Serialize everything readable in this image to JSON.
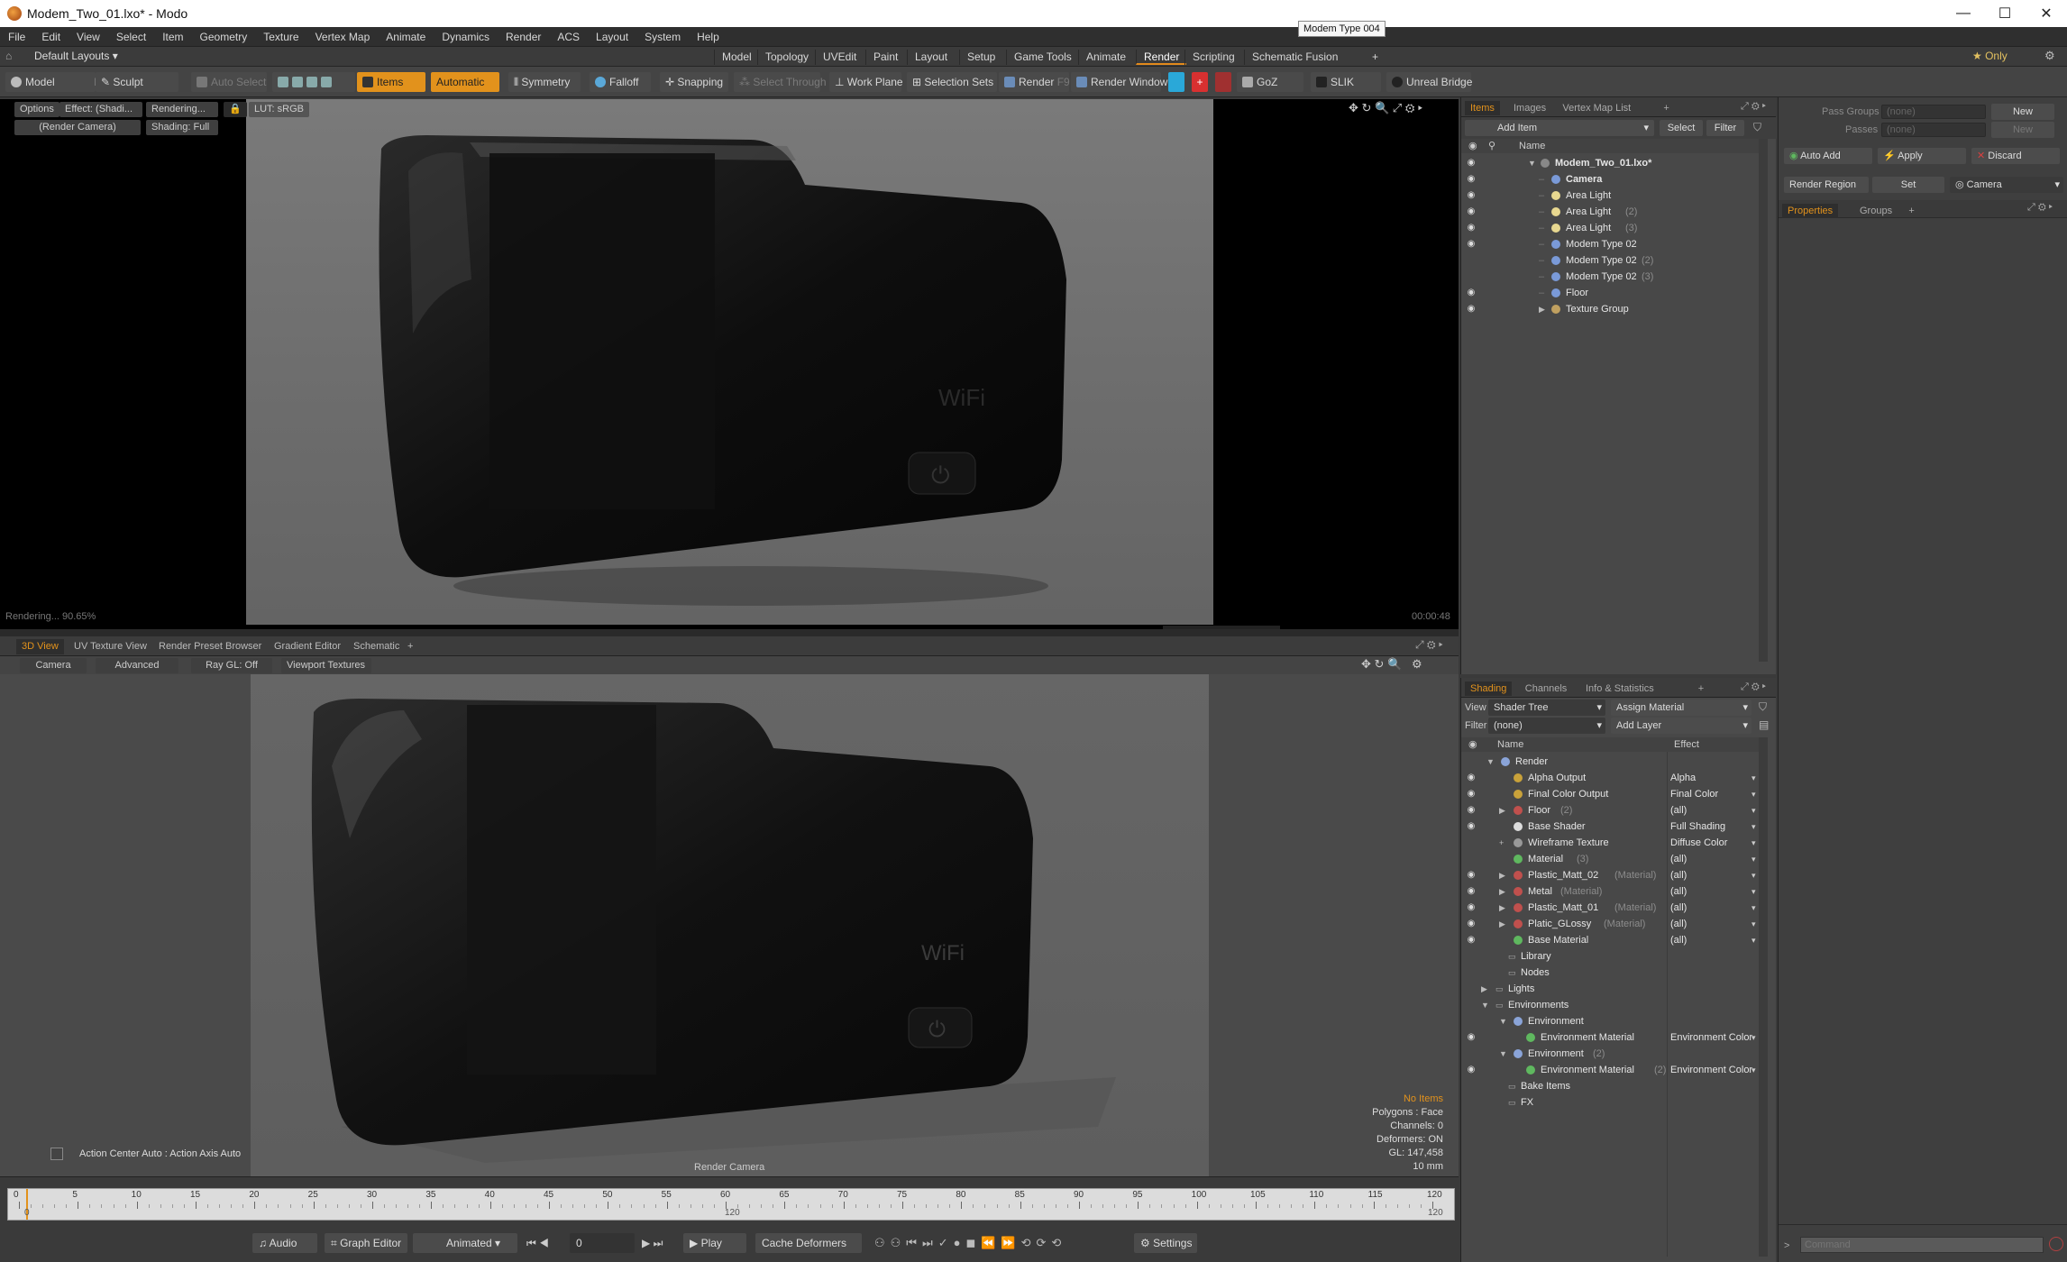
{
  "window": {
    "title": "Modem_Two_01.lxo* - Modo",
    "min": "—",
    "max": "☐",
    "close": "✕"
  },
  "tooltip": "Modem Type 004",
  "menu": [
    "File",
    "Edit",
    "View",
    "Select",
    "Item",
    "Geometry",
    "Texture",
    "Vertex Map",
    "Animate",
    "Dynamics",
    "Render",
    "ACS",
    "Layout",
    "System",
    "Help"
  ],
  "layoutbar": {
    "layouts": "Default Layouts ▾",
    "tabs": [
      "Model",
      "Topology",
      "UVEdit",
      "Paint",
      "Layout",
      "Setup",
      "Game Tools",
      "Animate",
      "Render",
      "Scripting",
      "Schematic Fusion"
    ],
    "active_tab": "Render",
    "plus": "+",
    "only": "★ Only"
  },
  "toolbar": {
    "model": "Model",
    "f2": "F2",
    "sculpt": "Sculpt",
    "auto_select": "Auto Select",
    "items": "Items",
    "automatic": "Automatic",
    "symmetry": "Symmetry",
    "falloff": "Falloff",
    "snapping": "Snapping",
    "select_through": "Select Through",
    "work_plane": "Work Plane",
    "selection_sets": "Selection Sets",
    "render": "Render",
    "f9": "F9",
    "render_window": "Render Window",
    "goz": "GoZ",
    "slik": "SLIK",
    "unreal_bridge": "Unreal Bridge"
  },
  "viewport1": {
    "options": "Options",
    "effect": "Effect: (Shadi...",
    "rendering": "Rendering...",
    "camera": "(Render Camera)",
    "shading": "Shading: Full",
    "lut": "LUT: sRGB",
    "progress": "Rendering... 90.65%",
    "time": "00:00:48"
  },
  "viewport2": {
    "tabs": [
      "3D View",
      "UV Texture View",
      "Render Preset Browser",
      "Gradient Editor",
      "Schematic",
      "+"
    ],
    "active_tab": "3D View",
    "camera": "Camera",
    "advanced": "Advanced",
    "raygl": "Ray GL: Off",
    "textures": "Viewport Textures",
    "action_center": "Action Center Auto : Action Axis Auto",
    "camera_label": "Render Camera",
    "stats": {
      "no_items": "No Items",
      "polygons": "Polygons : Face",
      "channels": "Channels: 0",
      "deformers": "Deformers: ON",
      "gl": "GL: 147,458",
      "unit": "10 mm"
    }
  },
  "timeline": {
    "ticks": [
      "0",
      "5",
      "10",
      "15",
      "20",
      "25",
      "30",
      "35",
      "40",
      "45",
      "50",
      "55",
      "60",
      "65",
      "70",
      "75",
      "80",
      "85",
      "90",
      "95",
      "100",
      "105",
      "110",
      "115",
      "120"
    ],
    "start": "0",
    "mid": "120",
    "end": "120"
  },
  "bottombar": {
    "audio": "Audio",
    "graph_editor": "Graph Editor",
    "animated": "Animated",
    "frame": "0",
    "play": "Play",
    "cache_deformers": "Cache Deformers",
    "settings": "Settings"
  },
  "items_panel": {
    "tabs": [
      "Items",
      "Images",
      "Vertex Map List",
      "+"
    ],
    "active_tab": "Items",
    "add_item": "Add Item",
    "select": "Select",
    "filter": "Filter",
    "name_header": "Name",
    "rows": [
      {
        "label": "Modem_Two_01.lxo*",
        "sub": "",
        "indent": 0,
        "bold": true,
        "eye": true,
        "icon": "scene-icon",
        "arrow": "▼"
      },
      {
        "label": "Camera",
        "sub": "",
        "indent": 1,
        "bold": true,
        "eye": true,
        "icon": "camera-icon",
        "arrow": ""
      },
      {
        "label": "Area Light",
        "sub": "",
        "indent": 1,
        "bold": false,
        "eye": true,
        "icon": "light-icon",
        "arrow": ""
      },
      {
        "label": "Area Light",
        "sub": "(2)",
        "indent": 1,
        "bold": false,
        "eye": true,
        "icon": "light-icon",
        "arrow": ""
      },
      {
        "label": "Area Light",
        "sub": "(3)",
        "indent": 1,
        "bold": false,
        "eye": true,
        "icon": "light-icon",
        "arrow": ""
      },
      {
        "label": "Modem Type 02",
        "sub": "",
        "indent": 1,
        "bold": false,
        "eye": true,
        "icon": "mesh-icon",
        "arrow": ""
      },
      {
        "label": "Modem Type 02",
        "sub": "(2)",
        "indent": 1,
        "bold": false,
        "eye": false,
        "icon": "mesh-icon",
        "arrow": ""
      },
      {
        "label": "Modem Type 02",
        "sub": "(3)",
        "indent": 1,
        "bold": false,
        "eye": false,
        "icon": "mesh-icon",
        "arrow": ""
      },
      {
        "label": "Floor",
        "sub": "",
        "indent": 1,
        "bold": false,
        "eye": true,
        "icon": "mesh-icon",
        "arrow": ""
      },
      {
        "label": "Texture Group",
        "sub": "",
        "indent": 1,
        "bold": false,
        "eye": true,
        "icon": "group-icon",
        "arrow": "▶"
      }
    ]
  },
  "shading_panel": {
    "tabs": [
      "Shading",
      "Channels",
      "Info & Statistics",
      "+"
    ],
    "active_tab": "Shading",
    "view_label": "View",
    "view_value": "Shader Tree",
    "assign_material": "Assign Material",
    "filter_label": "Filter",
    "filter_value": "(none)",
    "add_layer": "Add Layer",
    "name_header": "Name",
    "effect_header": "Effect",
    "rows": [
      {
        "label": "Render",
        "sub": "",
        "effect": "",
        "indent": 0,
        "eye": false,
        "color": "#8aa4d8",
        "arrow": "▼"
      },
      {
        "label": "Alpha Output",
        "sub": "",
        "effect": "Alpha",
        "indent": 1,
        "eye": true,
        "color": "#c9a23a",
        "arrow": ""
      },
      {
        "label": "Final Color Output",
        "sub": "",
        "effect": "Final Color",
        "indent": 1,
        "eye": true,
        "color": "#c9a23a",
        "arrow": ""
      },
      {
        "label": "Floor",
        "sub": "(2)",
        "effect": "(all)",
        "indent": 1,
        "eye": true,
        "color": "#c0504d",
        "arrow": "▶"
      },
      {
        "label": "Base Shader",
        "sub": "",
        "effect": "Full Shading",
        "indent": 1,
        "eye": true,
        "color": "#dddddd",
        "arrow": ""
      },
      {
        "label": "Wireframe Texture",
        "sub": "",
        "effect": "Diffuse Color",
        "indent": 1,
        "eye": false,
        "color": "#999999",
        "arrow": "+"
      },
      {
        "label": "Material",
        "sub": "(3)",
        "effect": "(all)",
        "indent": 1,
        "eye": false,
        "color": "#5fb85f",
        "arrow": ""
      },
      {
        "label": "Plastic_Matt_02",
        "sub": "(Material)",
        "effect": "(all)",
        "indent": 1,
        "eye": true,
        "color": "#c0504d",
        "arrow": "▶"
      },
      {
        "label": "Metal",
        "sub": "(Material)",
        "effect": "(all)",
        "indent": 1,
        "eye": true,
        "color": "#c0504d",
        "arrow": "▶"
      },
      {
        "label": "Plastic_Matt_01",
        "sub": "(Material)",
        "effect": "(all)",
        "indent": 1,
        "eye": true,
        "color": "#c0504d",
        "arrow": "▶"
      },
      {
        "label": "Platic_GLossy",
        "sub": "(Material)",
        "effect": "(all)",
        "indent": 1,
        "eye": true,
        "color": "#c0504d",
        "arrow": "▶"
      },
      {
        "label": "Base Material",
        "sub": "",
        "effect": "(all)",
        "indent": 1,
        "eye": true,
        "color": "#5fb85f",
        "arrow": ""
      },
      {
        "label": "Library",
        "sub": "",
        "effect": "",
        "indent": 1,
        "eye": false,
        "color": "",
        "arrow": ""
      },
      {
        "label": "Nodes",
        "sub": "",
        "effect": "",
        "indent": 1,
        "eye": false,
        "color": "",
        "arrow": ""
      },
      {
        "label": "Lights",
        "sub": "",
        "effect": "",
        "indent": 0,
        "eye": false,
        "color": "",
        "arrow": "▶"
      },
      {
        "label": "Environments",
        "sub": "",
        "effect": "",
        "indent": 0,
        "eye": false,
        "color": "",
        "arrow": "▼"
      },
      {
        "label": "Environment",
        "sub": "",
        "effect": "",
        "indent": 1,
        "eye": false,
        "color": "#8aa4d8",
        "arrow": "▼"
      },
      {
        "label": "Environment Material",
        "sub": "",
        "effect": "Environment Color",
        "indent": 2,
        "eye": true,
        "color": "#5fb85f",
        "arrow": ""
      },
      {
        "label": "Environment",
        "sub": "(2)",
        "effect": "",
        "indent": 1,
        "eye": false,
        "color": "#8aa4d8",
        "arrow": "▼"
      },
      {
        "label": "Environment Material",
        "sub": "(2)",
        "effect": "Environment Color",
        "indent": 2,
        "eye": true,
        "color": "#5fb85f",
        "arrow": ""
      },
      {
        "label": "Bake Items",
        "sub": "",
        "effect": "",
        "indent": 1,
        "eye": false,
        "color": "",
        "arrow": ""
      },
      {
        "label": "FX",
        "sub": "",
        "effect": "",
        "indent": 1,
        "eye": false,
        "color": "",
        "arrow": ""
      }
    ]
  },
  "properties_panel": {
    "pass_groups": "Pass Groups",
    "passes": "Passes",
    "none": "(none)",
    "new": "New",
    "auto_add": "Auto Add",
    "apply": "Apply",
    "discard": "Discard",
    "render_region": "Render Region",
    "set": "Set",
    "camera": "Camera",
    "tabs": [
      "Properties",
      "Groups",
      "+"
    ],
    "active_tab": "Properties",
    "command_placeholder": "Command"
  },
  "colors": {
    "accent": "#e2921c",
    "panel": "#484848",
    "viewport_bg": "#000000"
  }
}
